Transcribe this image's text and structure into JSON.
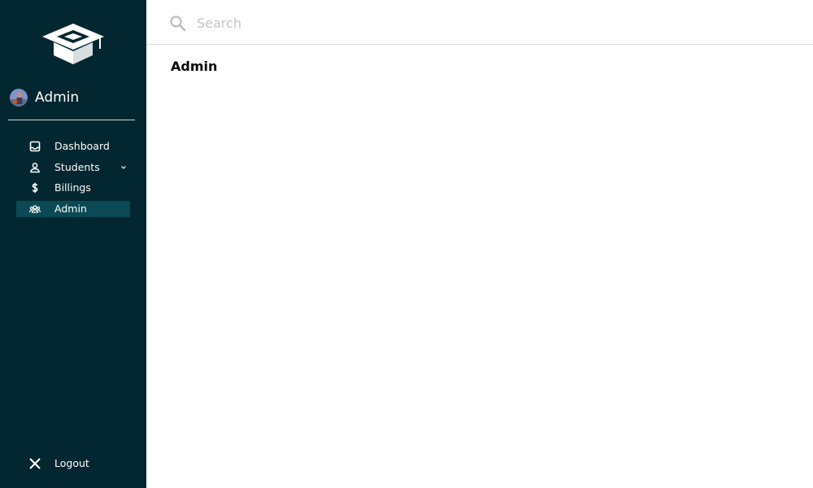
{
  "app": {
    "sidebar_bg": "#032730",
    "active_item_bg": "#0b4a55",
    "logo_icon": "graduation-cap-icon"
  },
  "profile": {
    "name": "Admin",
    "avatar_icon": "user-avatar"
  },
  "sidebar": {
    "items": [
      {
        "label": "Dashboard",
        "icon": "inbox-icon",
        "active": false
      },
      {
        "label": "Students",
        "icon": "person-icon",
        "active": false,
        "has_submenu": true
      },
      {
        "label": "Billings",
        "icon": "dollar-icon",
        "active": false
      },
      {
        "label": "Admin",
        "icon": "group-icon",
        "active": true
      }
    ],
    "logout_label": "Logout"
  },
  "search": {
    "placeholder": "Search",
    "value": ""
  },
  "main": {
    "title": "Admin"
  }
}
